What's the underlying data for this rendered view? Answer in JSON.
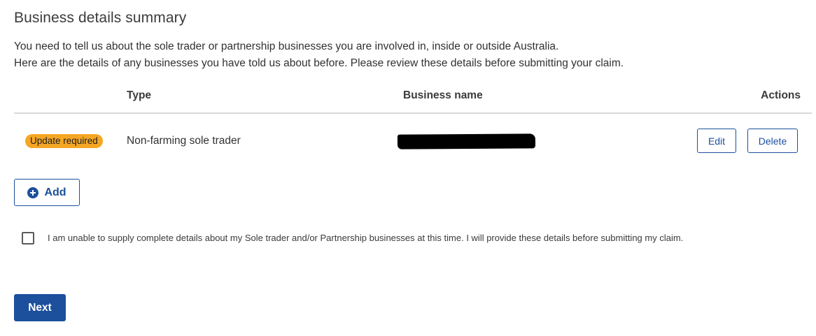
{
  "page": {
    "title": "Business details summary",
    "intro_line_1": "You need to tell us about the sole trader or partnership businesses you are involved in, inside or outside Australia.",
    "intro_line_2": "Here are the details of any businesses you have told us about before. Please review these details before submitting your claim."
  },
  "table": {
    "headers": {
      "type": "Type",
      "business_name": "Business name",
      "actions": "Actions"
    },
    "rows": [
      {
        "status": "Update required",
        "type": "Non-farming sole trader",
        "business_name_redacted": true,
        "edit_label": "Edit",
        "delete_label": "Delete"
      }
    ]
  },
  "add_button": {
    "label": "Add",
    "icon": "plus-circle-icon"
  },
  "confirmation": {
    "checked": false,
    "label": "I am unable to supply complete details about my Sole trader and/or Partnership businesses at this time. I will provide these details before submitting my claim."
  },
  "next_button": {
    "label": "Next"
  },
  "colors": {
    "primary": "#1c4f9c",
    "badge_warning": "#f5a623",
    "divider": "#dadada",
    "text": "#313131"
  }
}
